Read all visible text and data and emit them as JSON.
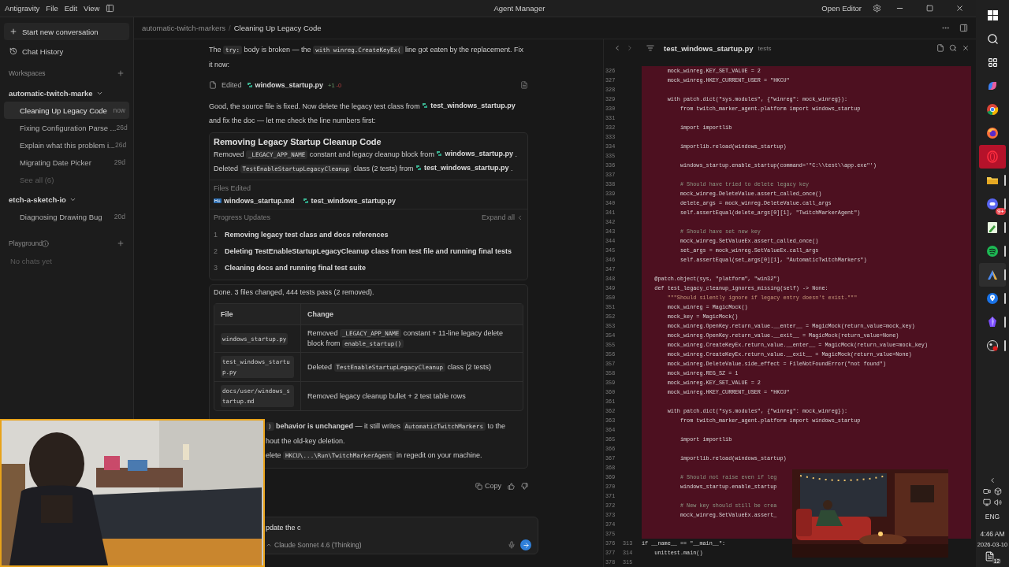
{
  "title_bar": {
    "app_name": "Antigravity",
    "menus": [
      "File",
      "Edit",
      "View"
    ],
    "title": "Agent Manager",
    "open_editor": "Open Editor"
  },
  "sidebar": {
    "new_conversation": "Start new conversation",
    "history": "Chat History",
    "workspaces_label": "Workspaces",
    "workspaces": [
      {
        "name": "automatic-twitch-marke",
        "expanded": true,
        "chats": [
          {
            "title": "Cleaning Up Legacy Code",
            "time": "now",
            "selected": true
          },
          {
            "title": "Fixing Configuration Parse ...",
            "time": "26d",
            "selected": false
          },
          {
            "title": "Explain what this problem i...",
            "time": "26d",
            "selected": false
          },
          {
            "title": "Migrating Date Picker",
            "time": "29d",
            "selected": false
          }
        ],
        "see_all": "See all (6)"
      },
      {
        "name": "etch-a-sketch-io",
        "expanded": true,
        "chats": [
          {
            "title": "Diagnosing Drawing Bug",
            "time": "20d",
            "selected": false
          }
        ]
      }
    ],
    "playground_label": "Playground",
    "playground_empty": "No chats yet"
  },
  "breadcrumb": {
    "items": [
      "automatic-twitch-markers",
      "Cleaning Up Legacy Code"
    ],
    "separator": "/"
  },
  "messages": [
    {
      "kind": "paragraph",
      "parts": [
        {
          "kind": "text",
          "text": "The "
        },
        {
          "kind": "code",
          "text": "try:"
        },
        {
          "kind": "text",
          "text": " body is broken — the "
        },
        {
          "kind": "code",
          "text": "with winreg.CreateKeyEx("
        },
        {
          "kind": "text",
          "text": " line got eaten by the replacement. Fix it now:"
        }
      ]
    },
    {
      "kind": "edit",
      "label": "Edited",
      "file": "windows_startup.py",
      "added": "+1",
      "removed": "-0"
    },
    {
      "kind": "paragraph",
      "parts": [
        {
          "kind": "text",
          "text": "Good, the source file is fixed. Now delete the legacy test class from "
        },
        {
          "kind": "file",
          "text": "test_windows_startup.py"
        },
        {
          "kind": "text",
          "text": " and fix the doc — let me check the line numbers first:"
        }
      ]
    },
    {
      "kind": "task",
      "title": "Removing Legacy Startup Cleanup Code",
      "lines": [
        [
          {
            "kind": "text",
            "text": "Removed "
          },
          {
            "kind": "code",
            "text": "_LEGACY_APP_NAME"
          },
          {
            "kind": "text",
            "text": " constant and legacy cleanup block from "
          },
          {
            "kind": "file",
            "text": "windows_startup.py"
          },
          {
            "kind": "text",
            "text": " ."
          }
        ],
        [
          {
            "kind": "text",
            "text": "Deleted "
          },
          {
            "kind": "code",
            "text": "TestEnableStartupLegacyCleanup"
          },
          {
            "kind": "text",
            "text": " class (2 tests) from "
          },
          {
            "kind": "file",
            "text": "test_windows_startup.py"
          },
          {
            "kind": "text",
            "text": " ."
          }
        ]
      ],
      "files_label": "Files Edited",
      "files": [
        {
          "name": "windows_startup.md",
          "kind": "md"
        },
        {
          "name": "test_windows_startup.py",
          "kind": "py"
        }
      ],
      "progress_label": "Progress Updates",
      "expand": "Expand all",
      "steps": [
        {
          "number": "1",
          "text": "Removing legacy test class and docs references"
        },
        {
          "number": "2",
          "text": "Deleting TestEnableStartupLegacyCleanup class from test file and running final tests"
        },
        {
          "number": "3",
          "text": "Cleaning docs and running final test suite"
        }
      ]
    },
    {
      "kind": "summary",
      "text": "Done. 3 files changed, 444 tests pass (2 removed).",
      "columns": [
        "File",
        "Change"
      ],
      "rows": [
        {
          "file": "windows_startup.py",
          "change": [
            {
              "kind": "text",
              "text": "Removed "
            },
            {
              "kind": "code",
              "text": "_LEGACY_APP_NAME"
            },
            {
              "kind": "text",
              "text": " constant + 11-line legacy delete block from "
            },
            {
              "kind": "code",
              "text": "enable_startup()"
            }
          ]
        },
        {
          "file": "test_windows_startup.py",
          "change": [
            {
              "kind": "text",
              "text": "Deleted "
            },
            {
              "kind": "code",
              "text": "TestEnableStartupLegacyCleanup"
            },
            {
              "kind": "text",
              "text": " class (2 tests)"
            }
          ]
        },
        {
          "file": "docs/user/windows_startup.md",
          "change": [
            {
              "kind": "text",
              "text": "Removed legacy cleanup bullet + 2 test table rows"
            }
          ]
        }
      ],
      "notes": [
        [
          {
            "kind": "code",
            "text": ")"
          },
          {
            "kind": "bold",
            "text": " behavior is unchanged"
          },
          {
            "kind": "text",
            "text": " — it still writes "
          },
          {
            "kind": "code",
            "text": "AutomaticTwitchMarkers"
          },
          {
            "kind": "text",
            "text": " to the"
          }
        ],
        [
          {
            "kind": "text",
            "text": "hout the old-key deletion."
          }
        ],
        [
          {
            "kind": "text",
            "text": "elete "
          },
          {
            "kind": "code",
            "text": "HKCU\\...\\Run\\TwitchMarkerAgent"
          },
          {
            "kind": "text",
            "text": " in regedit on your machine."
          }
        ]
      ]
    }
  ],
  "actions": {
    "copy": "Copy"
  },
  "composer": {
    "value": "pdate the c",
    "model": "Claude Sonnet 4.6 (Thinking)"
  },
  "editor": {
    "file": "test_windows_startup.py",
    "folder": "tests",
    "lines": [
      {
        "old": "326",
        "text": "        mock_winreg.KEY_SET_VALUE = 2",
        "kind": "code",
        "deleted": true
      },
      {
        "old": "327",
        "text": "        mock_winreg.HKEY_CURRENT_USER = \"HKCU\"",
        "kind": "code",
        "deleted": true
      },
      {
        "old": "328",
        "kind": "blank",
        "deleted": true
      },
      {
        "old": "329",
        "text": "        with patch.dict(\"sys.modules\", {\"winreg\": mock_winreg}):",
        "kind": "code",
        "deleted": true
      },
      {
        "old": "330",
        "text": "            from twitch_marker_agent.platform import windows_startup",
        "kind": "code",
        "deleted": true
      },
      {
        "old": "331",
        "kind": "blank",
        "deleted": true
      },
      {
        "old": "332",
        "text": "            import importlib",
        "kind": "code",
        "deleted": true
      },
      {
        "old": "333",
        "kind": "blank",
        "deleted": true
      },
      {
        "old": "334",
        "text": "            importlib.reload(windows_startup)",
        "kind": "code",
        "deleted": true
      },
      {
        "old": "335",
        "kind": "blank",
        "deleted": true
      },
      {
        "old": "336",
        "text": "            windows_startup.enable_startup(command='\"C:\\\\test\\\\app.exe\"')",
        "kind": "code",
        "deleted": true
      },
      {
        "old": "337",
        "kind": "blank",
        "deleted": true
      },
      {
        "old": "338",
        "text": "            # Should have tried to delete legacy key",
        "kind": "comment",
        "deleted": true
      },
      {
        "old": "339",
        "text": "            mock_winreg.DeleteValue.assert_called_once()",
        "kind": "code",
        "deleted": true
      },
      {
        "old": "340",
        "text": "            delete_args = mock_winreg.DeleteValue.call_args",
        "kind": "code",
        "deleted": true
      },
      {
        "old": "341",
        "text": "            self.assertEqual(delete_args[0][1], \"TwitchMarkerAgent\")",
        "kind": "code",
        "deleted": true
      },
      {
        "old": "342",
        "kind": "blank",
        "deleted": true
      },
      {
        "old": "343",
        "text": "            # Should have set new key",
        "kind": "comment",
        "deleted": true
      },
      {
        "old": "344",
        "text": "            mock_winreg.SetValueEx.assert_called_once()",
        "kind": "code",
        "deleted": true
      },
      {
        "old": "345",
        "text": "            set_args = mock_winreg.SetValueEx.call_args",
        "kind": "code",
        "deleted": true
      },
      {
        "old": "346",
        "text": "            self.assertEqual(set_args[0][1], \"AutomaticTwitchMarkers\")",
        "kind": "code",
        "deleted": true
      },
      {
        "old": "347",
        "kind": "blank",
        "deleted": true
      },
      {
        "old": "348",
        "text": "    @patch.object(sys, \"platform\", \"win32\")",
        "kind": "code",
        "deleted": true
      },
      {
        "old": "349",
        "text": "    def test_legacy_cleanup_ignores_missing(self) -> None:",
        "kind": "code",
        "deleted": true
      },
      {
        "old": "350",
        "text": "        \"\"\"Should silently ignore if legacy entry doesn't exist.\"\"\"",
        "kind": "docstring",
        "deleted": true
      },
      {
        "old": "351",
        "text": "        mock_winreg = MagicMock()",
        "kind": "code",
        "deleted": true
      },
      {
        "old": "352",
        "text": "        mock_key = MagicMock()",
        "kind": "code",
        "deleted": true
      },
      {
        "old": "353",
        "text": "        mock_winreg.OpenKey.return_value.__enter__ = MagicMock(return_value=mock_key)",
        "kind": "code",
        "deleted": true
      },
      {
        "old": "354",
        "text": "        mock_winreg.OpenKey.return_value.__exit__ = MagicMock(return_value=None)",
        "kind": "code",
        "deleted": true
      },
      {
        "old": "355",
        "text": "        mock_winreg.CreateKeyEx.return_value.__enter__ = MagicMock(return_value=mock_key)",
        "kind": "code",
        "deleted": true
      },
      {
        "old": "356",
        "text": "        mock_winreg.CreateKeyEx.return_value.__exit__ = MagicMock(return_value=None)",
        "kind": "code",
        "deleted": true
      },
      {
        "old": "357",
        "text": "        mock_winreg.DeleteValue.side_effect = FileNotFoundError(\"not found\")",
        "kind": "code",
        "deleted": true
      },
      {
        "old": "358",
        "text": "        mock_winreg.REG_SZ = 1",
        "kind": "code",
        "deleted": true
      },
      {
        "old": "359",
        "text": "        mock_winreg.KEY_SET_VALUE = 2",
        "kind": "code",
        "deleted": true
      },
      {
        "old": "360",
        "text": "        mock_winreg.HKEY_CURRENT_USER = \"HKCU\"",
        "kind": "code",
        "deleted": true
      },
      {
        "old": "361",
        "kind": "blank",
        "deleted": true
      },
      {
        "old": "362",
        "text": "        with patch.dict(\"sys.modules\", {\"winreg\": mock_winreg}):",
        "kind": "code",
        "deleted": true
      },
      {
        "old": "363",
        "text": "            from twitch_marker_agent.platform import windows_startup",
        "kind": "code",
        "deleted": true
      },
      {
        "old": "364",
        "kind": "blank",
        "deleted": true
      },
      {
        "old": "365",
        "text": "            import importlib",
        "kind": "code",
        "deleted": true
      },
      {
        "old": "366",
        "kind": "blank",
        "deleted": true
      },
      {
        "old": "367",
        "text": "            importlib.reload(windows_startup)",
        "kind": "code",
        "deleted": true
      },
      {
        "old": "368",
        "kind": "blank",
        "deleted": true
      },
      {
        "old": "369",
        "text": "            # Should not raise even if leg",
        "kind": "comment",
        "deleted": true
      },
      {
        "old": "370",
        "text": "            windows_startup.enable_startup",
        "kind": "code",
        "deleted": true
      },
      {
        "old": "371",
        "kind": "blank",
        "deleted": true
      },
      {
        "old": "372",
        "text": "            # New key should still be crea",
        "kind": "comment",
        "deleted": true
      },
      {
        "old": "373",
        "text": "            mock_winreg.SetValueEx.assert_",
        "kind": "code",
        "deleted": true
      },
      {
        "old": "374",
        "kind": "blank",
        "deleted": true
      },
      {
        "old": "375",
        "kind": "blank",
        "deleted": true
      },
      {
        "old": "376",
        "new": "313",
        "text": "if __name__ == \"__main__\":",
        "kind": "code",
        "deleted": false
      },
      {
        "old": "377",
        "new": "314",
        "text": "    unittest.main()",
        "kind": "code",
        "deleted": false
      },
      {
        "old": "378",
        "new": "315",
        "kind": "blank",
        "deleted": false
      }
    ]
  },
  "taskbar": {
    "system": [
      {
        "kind": "start"
      },
      {
        "kind": "search"
      },
      {
        "kind": "task-view"
      }
    ],
    "apps": [
      {
        "kind": "copilot",
        "active": false,
        "alert": false,
        "open": false
      },
      {
        "kind": "chrome",
        "active": false,
        "alert": false,
        "open": false
      },
      {
        "kind": "firefox",
        "active": false,
        "alert": false,
        "open": false
      },
      {
        "kind": "opera",
        "active": false,
        "alert": true,
        "open": false
      },
      {
        "kind": "folder",
        "active": false,
        "alert": false,
        "open": true
      },
      {
        "kind": "chat",
        "active": false,
        "alert": false,
        "open": true,
        "badge": "9+"
      },
      {
        "kind": "notepad",
        "active": false,
        "alert": false,
        "open": true
      },
      {
        "kind": "music",
        "active": false,
        "alert": false,
        "open": true
      },
      {
        "kind": "editor",
        "active": true,
        "alert": false,
        "open": true
      },
      {
        "kind": "pin",
        "active": false,
        "alert": false,
        "open": true
      },
      {
        "kind": "gem",
        "active": false,
        "alert": false,
        "open": true
      },
      {
        "kind": "recorder",
        "active": false,
        "alert": false,
        "open": true
      }
    ],
    "tray": [
      {
        "kind": "chevron"
      },
      {
        "kind": "camera"
      },
      {
        "kind": "box"
      },
      {
        "kind": "monitor"
      },
      {
        "kind": "volume"
      }
    ],
    "language": "ENG",
    "time": "4:46 AM",
    "date": "2026-03-10",
    "notifications": "12"
  }
}
